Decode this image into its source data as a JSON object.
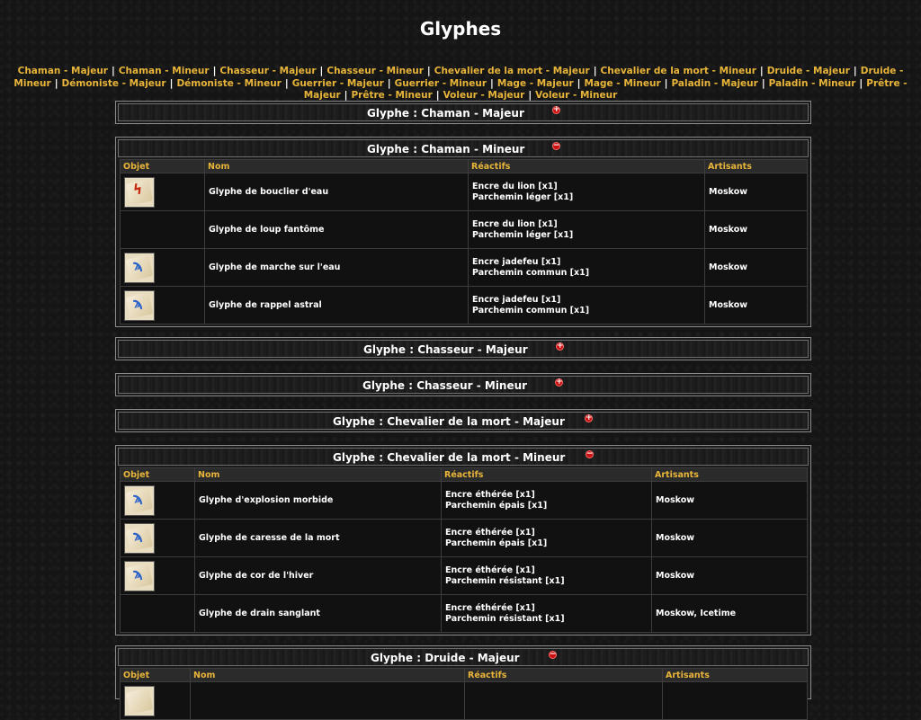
{
  "page_title": "Glyphes",
  "nav_links": [
    "Chaman - Majeur",
    "Chaman - Mineur",
    "Chasseur - Majeur",
    "Chasseur - Mineur",
    "Chevalier de la mort - Majeur",
    "Chevalier de la mort - Mineur",
    "Druide - Majeur",
    "Druide - Mineur",
    "Démoniste - Majeur",
    "Démoniste - Mineur",
    "Guerrier - Majeur",
    "Guerrier - Mineur",
    "Mage - Majeur",
    "Mage - Mineur",
    "Paladin - Majeur",
    "Paladin - Mineur",
    "Prêtre - Majeur",
    "Prêtre - Mineur",
    "Voleur - Majeur",
    "Voleur - Mineur"
  ],
  "nav_separator": "|",
  "columns": {
    "objet": "Objet",
    "nom": "Nom",
    "reactifs": "Réactifs",
    "artisans": "Artisants"
  },
  "colors": {
    "accent": "#e8b53a",
    "toggle": "#c81010",
    "border": "#8a8a8a"
  },
  "sections": {
    "chaman_majeur": {
      "title": "Glyphe : Chaman - Majeur",
      "toggle": "+"
    },
    "chaman_mineur": {
      "title": "Glyphe : Chaman - Mineur",
      "toggle": "−",
      "rows": [
        {
          "icon": "red-glyph-scroll-icon",
          "name": "Glyphe de bouclier d'eau",
          "reagent1": "Encre du lion [x1]",
          "reagent2": "Parchemin léger [x1]",
          "artisan": "Moskow"
        },
        {
          "icon": "",
          "name": "Glyphe de loup fantôme",
          "reagent1": "Encre du lion [x1]",
          "reagent2": "Parchemin léger [x1]",
          "artisan": "Moskow"
        },
        {
          "icon": "blue-glyph-scroll-icon",
          "name": "Glyphe de marche sur l'eau",
          "reagent1": "Encre jadefeu [x1]",
          "reagent2": "Parchemin commun [x1]",
          "artisan": "Moskow"
        },
        {
          "icon": "blue-glyph-scroll-icon",
          "name": "Glyphe de rappel astral",
          "reagent1": "Encre jadefeu [x1]",
          "reagent2": "Parchemin commun [x1]",
          "artisan": "Moskow"
        }
      ]
    },
    "chasseur_majeur": {
      "title": "Glyphe : Chasseur - Majeur",
      "toggle": "+"
    },
    "chasseur_mineur": {
      "title": "Glyphe : Chasseur - Mineur",
      "toggle": "+"
    },
    "cdlm_majeur": {
      "title": "Glyphe : Chevalier de la mort - Majeur",
      "toggle": "+"
    },
    "cdlm_mineur": {
      "title": "Glyphe : Chevalier de la mort - Mineur",
      "toggle": "−",
      "rows": [
        {
          "icon": "blue-glyph-scroll-icon",
          "name": "Glyphe d'explosion morbide",
          "reagent1": "Encre éthérée [x1]",
          "reagent2": "Parchemin épais [x1]",
          "artisan": "Moskow"
        },
        {
          "icon": "blue-glyph-scroll-icon",
          "name": "Glyphe de caresse de la mort",
          "reagent1": "Encre éthérée [x1]",
          "reagent2": "Parchemin épais [x1]",
          "artisan": "Moskow"
        },
        {
          "icon": "blue-glyph-scroll-icon",
          "name": "Glyphe de cor de l'hiver",
          "reagent1": "Encre éthérée [x1]",
          "reagent2": "Parchemin résistant [x1]",
          "artisan": "Moskow"
        },
        {
          "icon": "",
          "name": "Glyphe de drain sanglant",
          "reagent1": "Encre éthérée [x1]",
          "reagent2": "Parchemin résistant [x1]",
          "artisan": "Moskow",
          "artisan2": "Icetime"
        }
      ]
    },
    "druide_majeur": {
      "title": "Glyphe : Druide - Majeur",
      "toggle": "−"
    }
  }
}
